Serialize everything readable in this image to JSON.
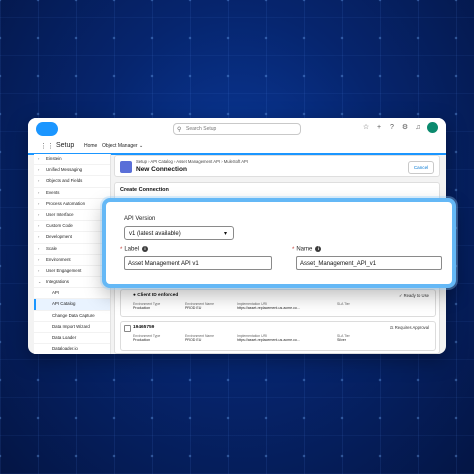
{
  "app": {
    "name": "Setup",
    "search_placeholder": "Search Setup"
  },
  "nav": {
    "tabs": [
      {
        "label": "Home"
      },
      {
        "label": "Object Manager"
      }
    ]
  },
  "sidebar": {
    "items": [
      {
        "label": "Einstein"
      },
      {
        "label": "Unified Messaging"
      },
      {
        "label": "Objects and Fields"
      },
      {
        "label": "Events"
      },
      {
        "label": "Process Automation"
      },
      {
        "label": "User Interface"
      },
      {
        "label": "Custom Code"
      },
      {
        "label": "Development"
      },
      {
        "label": "Scale"
      },
      {
        "label": "Environment"
      },
      {
        "label": "User Engagement"
      },
      {
        "label": "Integrations"
      },
      {
        "label": "API"
      },
      {
        "label": "API Catalog"
      },
      {
        "label": "Change Data Capture"
      },
      {
        "label": "Data Import Wizard"
      },
      {
        "label": "Data Loader"
      },
      {
        "label": "Dataloader.io"
      }
    ]
  },
  "page": {
    "breadcrumb": "Setup › API Catalog › Asset Management API › MuleSoft API",
    "title": "New Connection",
    "cancel_label": "Cancel",
    "section_title": "Create Connection"
  },
  "environments": {
    "columns": [
      "Environment Type",
      "Environment Name",
      "Implementation URI",
      "SLA Tier"
    ],
    "row1": {
      "header": "Client ID enforced",
      "status": "Ready to Use",
      "values": [
        "Production",
        "PROD EU",
        "https://asset-replacement-us.acme.co...",
        ""
      ]
    },
    "row2": {
      "header": "19465759",
      "status": "Requires Approval",
      "values": [
        "Production",
        "PROD EU",
        "https://asset-replacement-us.acme.co...",
        "Silver"
      ]
    }
  },
  "form": {
    "api_version_label": "API Version",
    "api_version_value": "v1 (latest available)",
    "label_label": "Label",
    "label_value": "Asset Management API v1",
    "name_label": "Name",
    "name_value": "Asset_Management_API_v1",
    "required_marker": "*"
  },
  "colors": {
    "bg": "#06256e",
    "brand": "#1b96ff",
    "highlight": "#64b8f6"
  }
}
